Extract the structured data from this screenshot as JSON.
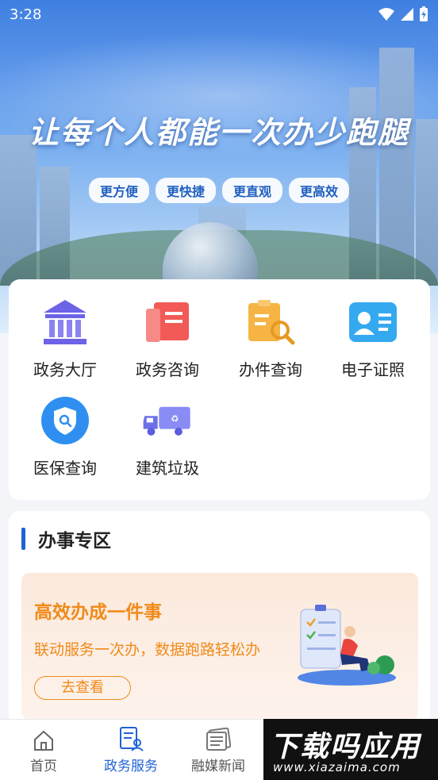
{
  "status_bar": {
    "time": "3:28"
  },
  "hero": {
    "slogan": "让每个人都能一次办少跑腿",
    "tags": [
      "更方便",
      "更快捷",
      "更直观",
      "更高效"
    ]
  },
  "services": [
    {
      "label": "政务大厅",
      "icon": "government-hall-icon",
      "color": "#6c63e6"
    },
    {
      "label": "政务咨询",
      "icon": "consult-book-icon",
      "color": "#f25a57"
    },
    {
      "label": "办件查询",
      "icon": "document-search-icon",
      "color": "#f5b443"
    },
    {
      "label": "电子证照",
      "icon": "id-card-icon",
      "color": "#35a9f0"
    },
    {
      "label": "医保查询",
      "icon": "medical-shield-icon",
      "color": "#2f8ff0"
    },
    {
      "label": "建筑垃圾",
      "icon": "garbage-truck-icon",
      "color": "#7c7cf2"
    }
  ],
  "section": {
    "title": "办事专区",
    "banner": {
      "title": "高效办成一件事",
      "subtitle": "联动服务一次办，数据跑路轻松办",
      "button": "去查看"
    }
  },
  "tabbar": [
    {
      "label": "首页",
      "icon": "home-icon",
      "active": false
    },
    {
      "label": "政务服务",
      "icon": "gov-service-icon",
      "active": true
    },
    {
      "label": "融媒新闻",
      "icon": "news-icon",
      "active": false
    }
  ],
  "watermark": {
    "main": "下载吗应用",
    "sub": "www.xiazaima.com"
  },
  "colors": {
    "accent": "#1f62d6",
    "banner_text": "#f08a1a"
  }
}
